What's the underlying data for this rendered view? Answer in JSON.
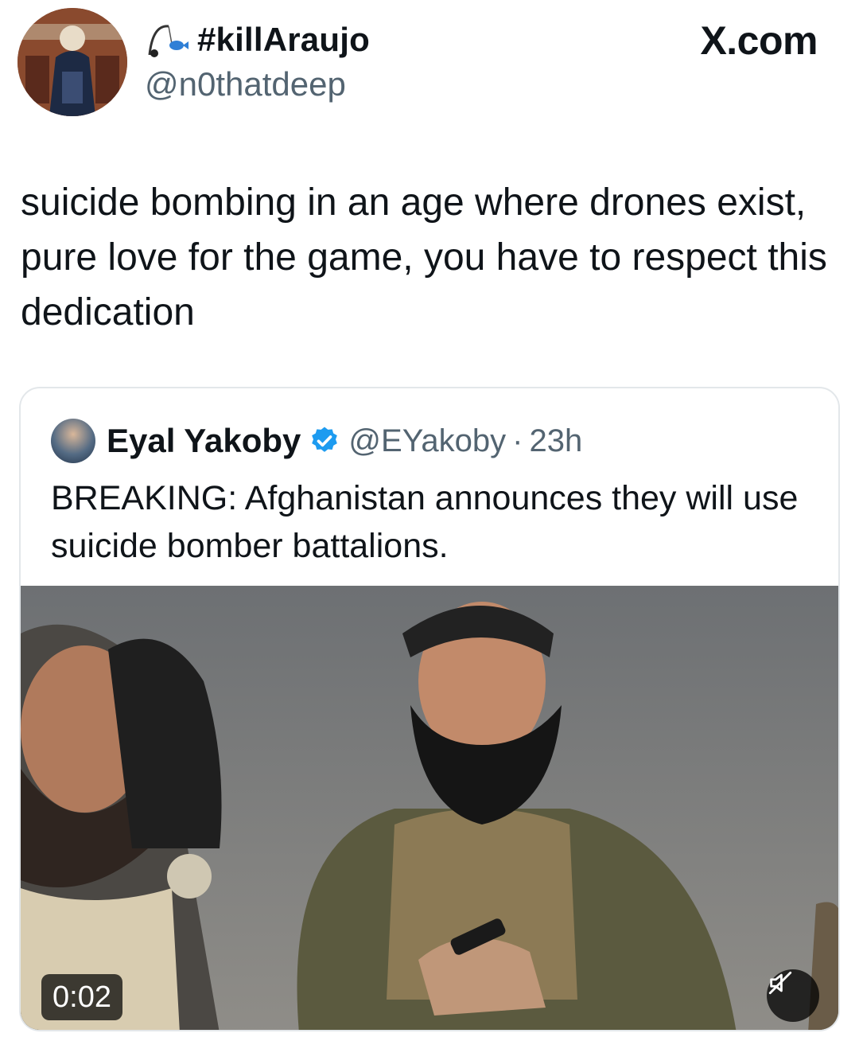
{
  "header": {
    "display_name": "#killAraujo",
    "handle": "@n0thatdeep",
    "site": "X.com",
    "name_icon": "fishing-rod-icon",
    "avatar_icon": "profile-avatar"
  },
  "tweet": {
    "text": "suicide bombing in an age where drones exist, pure love for the game, you have to respect this dedication"
  },
  "quote": {
    "author_name": "Eyal Yakoby",
    "author_handle": "@EYakoby",
    "separator": "·",
    "time": "23h",
    "verified_icon": "verified-badge-icon",
    "text": "BREAKING: Afghanistan announces they will use suicide bomber battalions.",
    "media": {
      "duration": "0:02",
      "mute_icon": "speaker-muted-icon"
    }
  },
  "colors": {
    "text_primary": "#0f1419",
    "text_secondary": "#536471",
    "verified": "#1d9bf0",
    "card_border": "#e3e7ea"
  }
}
